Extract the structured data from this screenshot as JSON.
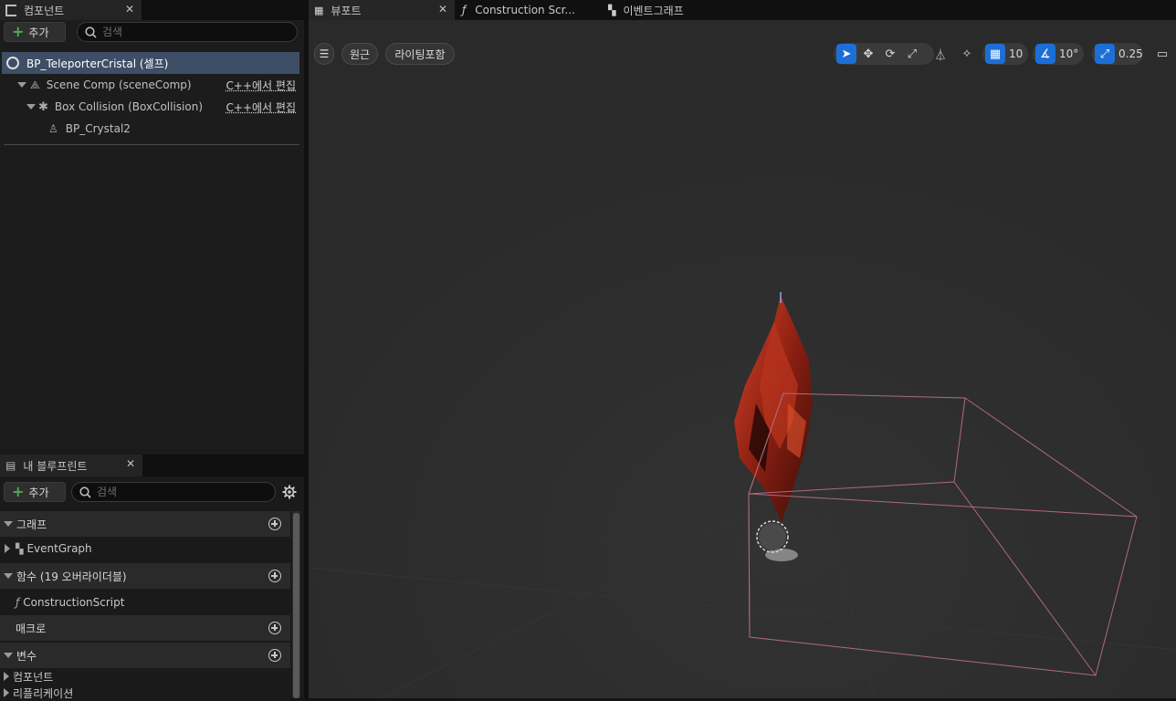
{
  "components_panel": {
    "tab_label": "컴포넌트",
    "add_label": "추가",
    "search_placeholder": "검색",
    "tree": {
      "root_label": "BP_TeleporterCristal (셀프)",
      "scene_comp": "Scene Comp (sceneComp)",
      "box_collision": "Box Collision (BoxCollision)",
      "crystal": "BP_Crystal2",
      "edit_in_cpp": "C++에서 편집"
    }
  },
  "blueprint_panel": {
    "tab_label": "내 블루프린트",
    "add_label": "추가",
    "search_placeholder": "검색",
    "sections": {
      "graph": "그래프",
      "event_graph": "EventGraph",
      "functions": "함수 (19 오버라이더블)",
      "construction_script": "ConstructionScript",
      "macros": "매크로",
      "variables": "변수",
      "components": "컴포넌트",
      "replication": "리플리케이션"
    }
  },
  "editor_tabs": {
    "viewport": "뷰포트",
    "construction_script": "Construction Scr...",
    "event_graph": "이벤트그래프"
  },
  "viewport_toolbar": {
    "perspective": "원근",
    "lighting": "라이팅포함",
    "grid_snap": "10",
    "rotation_snap": "10°",
    "scale_snap": "0.25"
  },
  "colors": {
    "accent": "#1b6fd6",
    "selection": "#3d4e66",
    "box_wire": "#b06a7a",
    "crystal": "#c0351c"
  }
}
